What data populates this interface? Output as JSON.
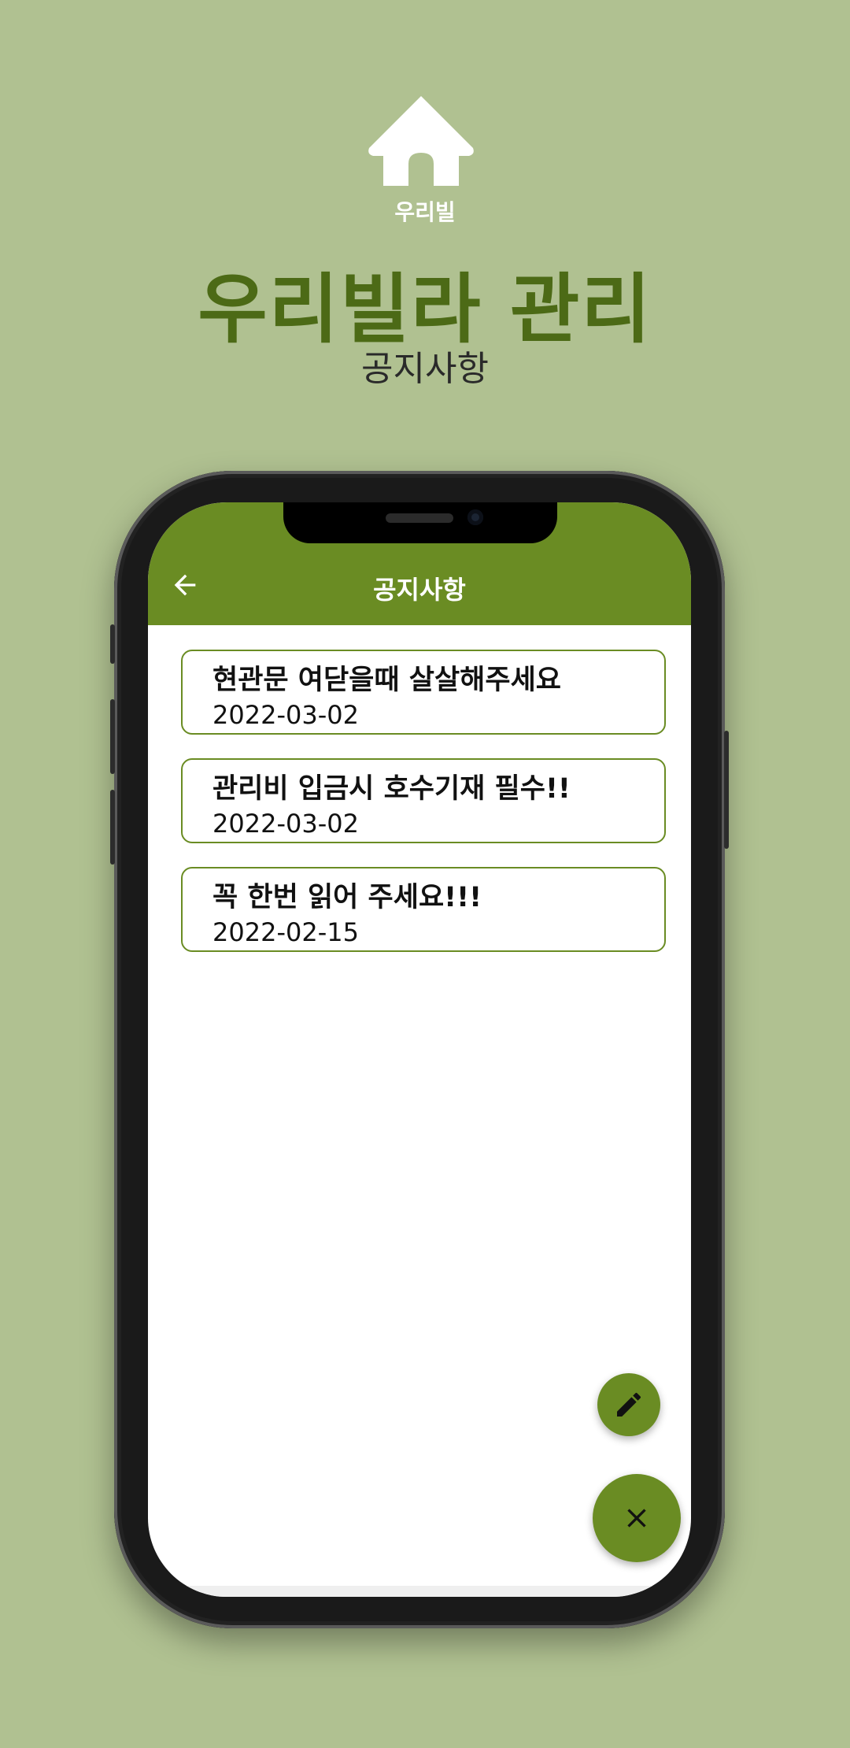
{
  "promo": {
    "logo_text": "우리빌",
    "title": "우리빌라 관리",
    "subtitle": "공지사항"
  },
  "app": {
    "title": "공지사항",
    "notices": [
      {
        "title": "현관문 여닫을때 살살해주세요",
        "date": "2022-03-02"
      },
      {
        "title": "관리비 입금시 호수기재 필수!!",
        "date": "2022-03-02"
      },
      {
        "title": "꼭 한번 읽어 주세요!!!",
        "date": "2022-02-15"
      }
    ]
  },
  "icons": {
    "logo": "house-icon",
    "back": "arrow-left-icon",
    "edit": "pencil-icon",
    "close": "close-icon"
  },
  "colors": {
    "background": "#b0c191",
    "accent": "#6a8c23",
    "title": "#4c6a16"
  }
}
